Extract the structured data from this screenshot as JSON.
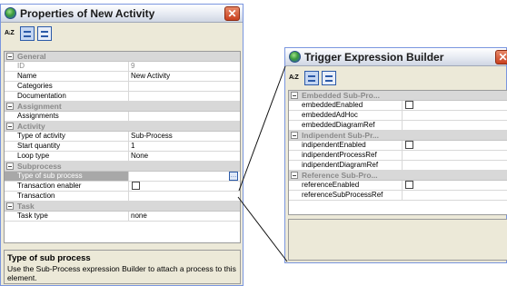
{
  "properties_window": {
    "title": "Properties of New Activity",
    "close_label": "✕",
    "sort_label": "A↓Z",
    "categories": [
      {
        "label": "General",
        "rows": [
          {
            "name": "ID",
            "value": "9",
            "disabled": true
          },
          {
            "name": "Name",
            "value": "New Activity"
          },
          {
            "name": "Categories",
            "value": ""
          },
          {
            "name": "Documentation",
            "value": ""
          }
        ]
      },
      {
        "label": "Assignment",
        "rows": [
          {
            "name": "Assignments",
            "value": ""
          }
        ]
      },
      {
        "label": "Activity",
        "rows": [
          {
            "name": "Type of activity",
            "value": "Sub-Process"
          },
          {
            "name": "Start quantity",
            "value": "1"
          },
          {
            "name": "Loop type",
            "value": "None"
          }
        ]
      },
      {
        "label": "Subprocess",
        "rows": [
          {
            "name": "Type of sub process",
            "value": "",
            "selected": true
          },
          {
            "name": "Transaction enabler",
            "value": "",
            "checkbox": true
          },
          {
            "name": "Transaction",
            "value": ""
          }
        ]
      },
      {
        "label": "Task",
        "rows": [
          {
            "name": "Task type",
            "value": "none"
          }
        ]
      }
    ],
    "description": {
      "title": "Type of sub process",
      "text": "Use the Sub-Process expression Builder to attach a process to this element."
    }
  },
  "trigger_window": {
    "title": "Trigger Expression Builder",
    "close_label": "✕",
    "sort_label": "A↓Z",
    "categories": [
      {
        "label": "Embedded Sub-Pro...",
        "rows": [
          {
            "name": "embeddedEnabled",
            "value": "",
            "checkbox": true
          },
          {
            "name": "embeddedAdHoc",
            "value": ""
          },
          {
            "name": "embeddedDiagramRef",
            "value": ""
          }
        ]
      },
      {
        "label": "Indipendent Sub-Pr...",
        "rows": [
          {
            "name": "indipendentEnabled",
            "value": "",
            "checkbox": true
          },
          {
            "name": "indipendentProcessRef",
            "value": ""
          },
          {
            "name": "indipendentDiagramRef",
            "value": ""
          }
        ]
      },
      {
        "label": "Reference Sub-Pro...",
        "rows": [
          {
            "name": "referenceEnabled",
            "value": "",
            "checkbox": true
          },
          {
            "name": "referenceSubProcessRef",
            "value": ""
          }
        ]
      }
    ]
  }
}
